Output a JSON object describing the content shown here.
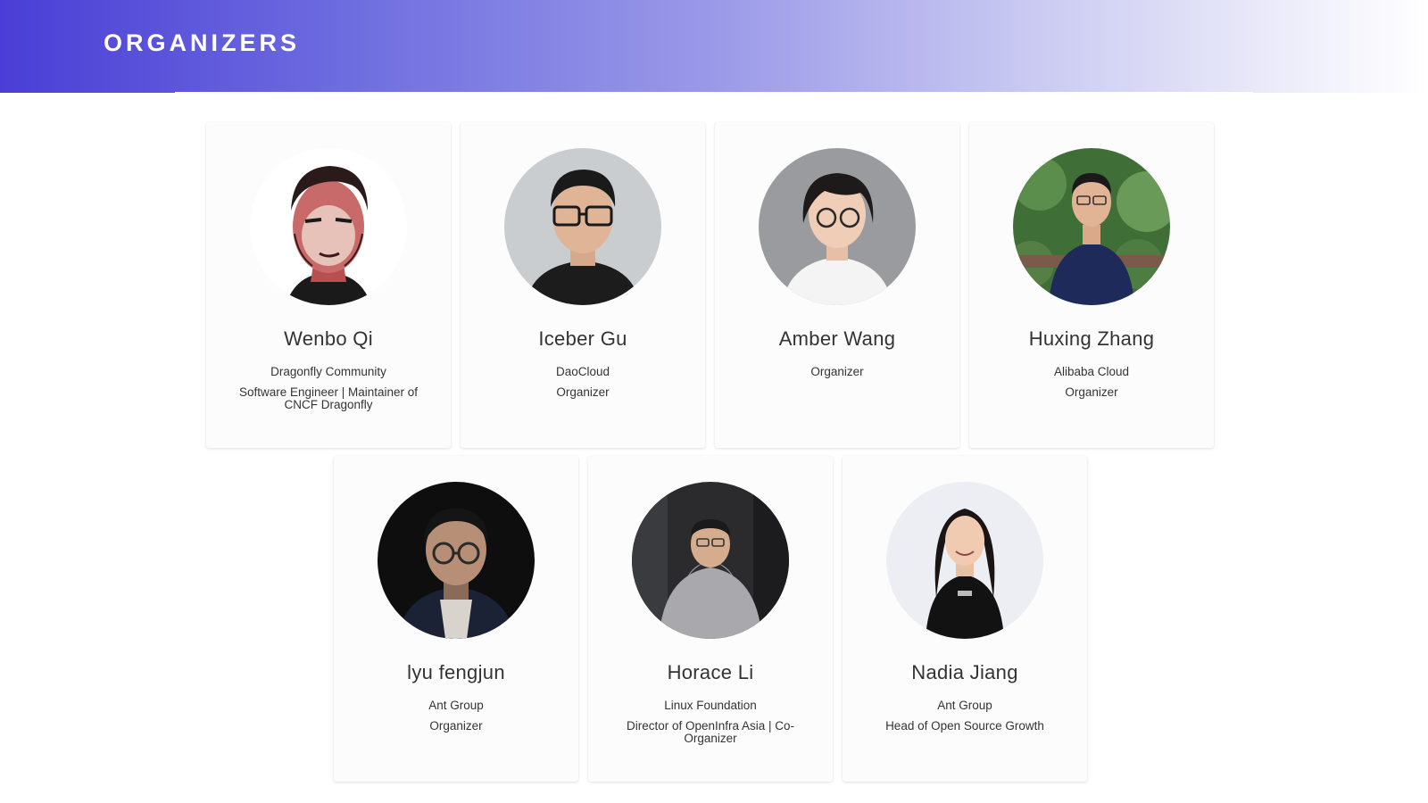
{
  "header": {
    "title": "ORGANIZERS"
  },
  "organizers": [
    {
      "name": "Wenbo Qi",
      "company": "Dragonfly Community",
      "role": "Software Engineer | Maintainer of CNCF Dragonfly",
      "avatar_icon": "portrait-illustration-icon"
    },
    {
      "name": "Iceber Gu",
      "company": "DaoCloud",
      "role": "Organizer",
      "avatar_icon": "portrait-photo-icon"
    },
    {
      "name": "Amber Wang",
      "company": "Organizer",
      "role": "",
      "avatar_icon": "portrait-photo-icon"
    },
    {
      "name": "Huxing Zhang",
      "company": "Alibaba Cloud",
      "role": "Organizer",
      "avatar_icon": "portrait-photo-icon"
    },
    {
      "name": "lyu fengjun",
      "company": "Ant Group",
      "role": "Organizer",
      "avatar_icon": "portrait-photo-icon"
    },
    {
      "name": "Horace Li",
      "company": "Linux Foundation",
      "role": "Director of OpenInfra Asia | Co-Organizer",
      "avatar_icon": "portrait-photo-icon"
    },
    {
      "name": "Nadia Jiang",
      "company": "Ant Group",
      "role": "Head of Open Source Growth",
      "avatar_icon": "portrait-photo-icon"
    }
  ],
  "colors": {
    "header_gradient_start": "#4a3ed6",
    "header_gradient_end": "#ffffff",
    "card_background": "#fcfcfc",
    "text": "#333333"
  }
}
